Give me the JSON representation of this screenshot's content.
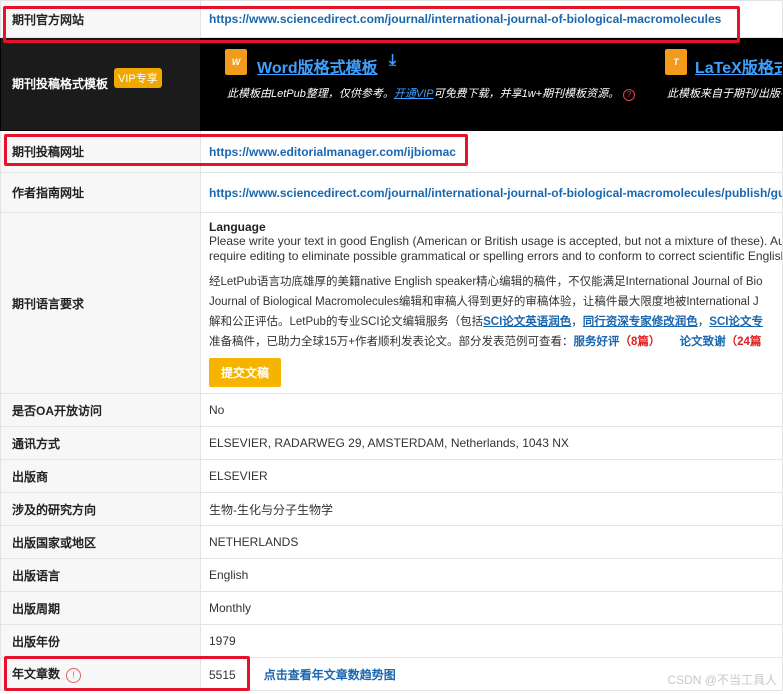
{
  "rows": {
    "official_site": {
      "label": "期刊官方网站",
      "url": "https://www.sciencedirect.com/journal/international-journal-of-biological-macromolecules"
    },
    "template": {
      "label": "期刊投稿格式模板",
      "vip": "VIP专享",
      "word_title": "Word版格式模板",
      "word_desc_pre": "此模板由LetPub整理，仅供参考。",
      "word_desc_link": "开通VIP",
      "word_desc_post": "可免费下载，并享1w+期刊模板资源。",
      "latex_title": "LaTeX版格式",
      "latex_desc": "此模板来自于期刊/出版社"
    },
    "submission_site": {
      "label": "期刊投稿网址",
      "url": "https://www.editorialmanager.com/ijbiomac"
    },
    "author_guide": {
      "label": "作者指南网址",
      "url": "https://www.sciencedirect.com/journal/international-journal-of-biological-macromolecules/publish/gu"
    },
    "language": {
      "label": "期刊语言要求",
      "heading": "Language",
      "en_line1": "Please write your text in good English (American or British usage is accepted, but not a mixture of these). Au",
      "en_line2": "require editing to eliminate possible grammatical or spelling errors and to conform to correct scientific Englisl",
      "zh_line1": "经LetPub语言功底雄厚的美籍native English speaker精心编辑的稿件，不仅能满足International Journal of Bio",
      "zh_line2": "Journal of Biological Macromolecules编辑和审稿人得到更好的审稿体验，让稿件最大限度地被International J",
      "zh_line3_pre": "解和公正评估。LetPub的专业SCI论文编辑服务（包括",
      "link1": "SCI论文英语润色",
      "sep1": "，",
      "link2": "同行资深专家修改润色",
      "sep2": "，",
      "link3": "SCI论文专",
      "zh_line4_pre": "准备稿件，已助力全球15万+作者顺利发表论文。部分发表范例可查看：",
      "review_label": "服务好评",
      "review_count": "（8篇）",
      "thanks_label": "论文致谢",
      "thanks_count": "（24篇",
      "submit_button": "提交文稿"
    },
    "oa": {
      "label": "是否OA开放访问",
      "value": "No"
    },
    "contact": {
      "label": "通讯方式",
      "value": "ELSEVIER, RADARWEG 29, AMSTERDAM, Netherlands, 1043 NX"
    },
    "publisher": {
      "label": "出版商",
      "value": "ELSEVIER"
    },
    "research": {
      "label": "涉及的研究方向",
      "value": "生物-生化与分子生物学"
    },
    "country": {
      "label": "出版国家或地区",
      "value": "NETHERLANDS"
    },
    "pub_language": {
      "label": "出版语言",
      "value": "English"
    },
    "frequency": {
      "label": "出版周期",
      "value": "Monthly"
    },
    "year": {
      "label": "出版年份",
      "value": "1979"
    },
    "articles": {
      "label": "年文章数",
      "value": "5515",
      "trend_link": "点击查看年文章数趋势图"
    }
  },
  "watermark": "CSDN @不当工具人",
  "highlight_color": "#e5132a"
}
